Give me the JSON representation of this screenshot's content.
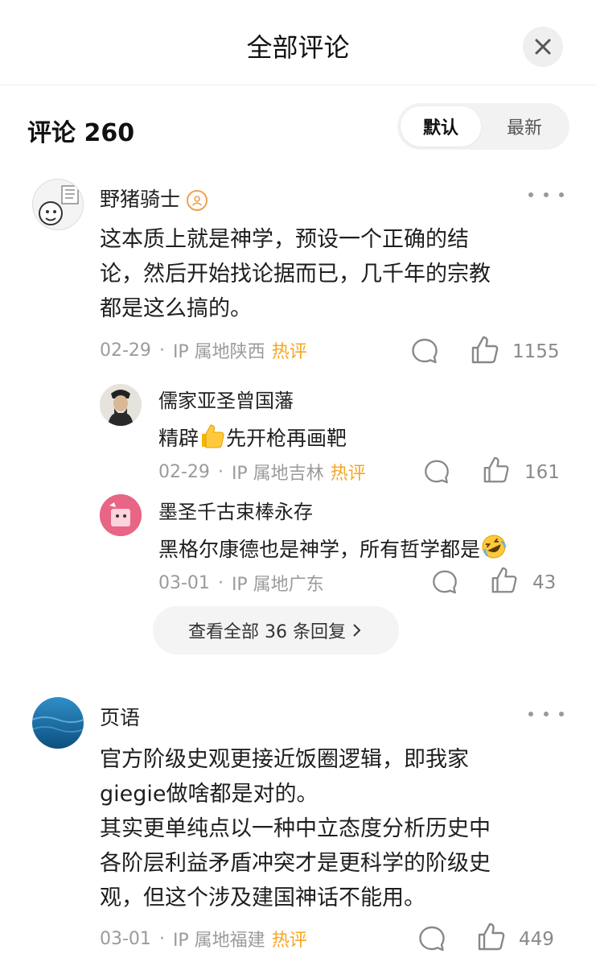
{
  "header": {
    "title": "全部评论",
    "close_icon": "close-icon"
  },
  "comments_meta": {
    "count_label": "评论 260",
    "sort_options": [
      "默认",
      "最新"
    ],
    "active_sort": "默认"
  },
  "comments": [
    {
      "user": "野猪骑士",
      "badge_icon": "verified-badge-icon",
      "text_lines": [
        "这本质上就是神学，预设一个正确的结",
        "论，然后开始找论据而已，几千年的宗教",
        "都是这么搞的。"
      ],
      "date": "02-29",
      "location": "IP 属地陕西",
      "hot": "热评",
      "likes": "1155",
      "replies": [
        {
          "user": "儒家亚圣曾国藩",
          "text_before": "精辟",
          "emoji": "thumbs-up-emoji",
          "text_after": "先开枪再画靶",
          "date": "02-29",
          "location": "IP 属地吉林",
          "hot": "热评",
          "likes": "161"
        },
        {
          "user": "墨圣千古束棒永存",
          "text_before": "黑格尔康德也是神学，所有哲学都是",
          "emoji": "rofl-emoji",
          "text_after": "",
          "date": "03-01",
          "location": "IP 属地广东",
          "hot": "",
          "likes": "43"
        }
      ],
      "view_all": "查看全部 36 条回复"
    },
    {
      "user": "页语",
      "text_lines": [
        "官方阶级史观更接近饭圈逻辑，即我家",
        "giegie做啥都是对的。",
        "其实更单纯点以一种中立态度分析历史中",
        "各阶层利益矛盾冲突才是更科学的阶级史",
        "观，但这个涉及建国神话不能用。"
      ],
      "date": "03-01",
      "location": "IP 属地福建",
      "hot": "热评",
      "likes": "449"
    }
  ],
  "colors": {
    "hot": "#f5a623",
    "meta": "#9b9b9b",
    "toggle_bg": "#f2f2f2"
  }
}
